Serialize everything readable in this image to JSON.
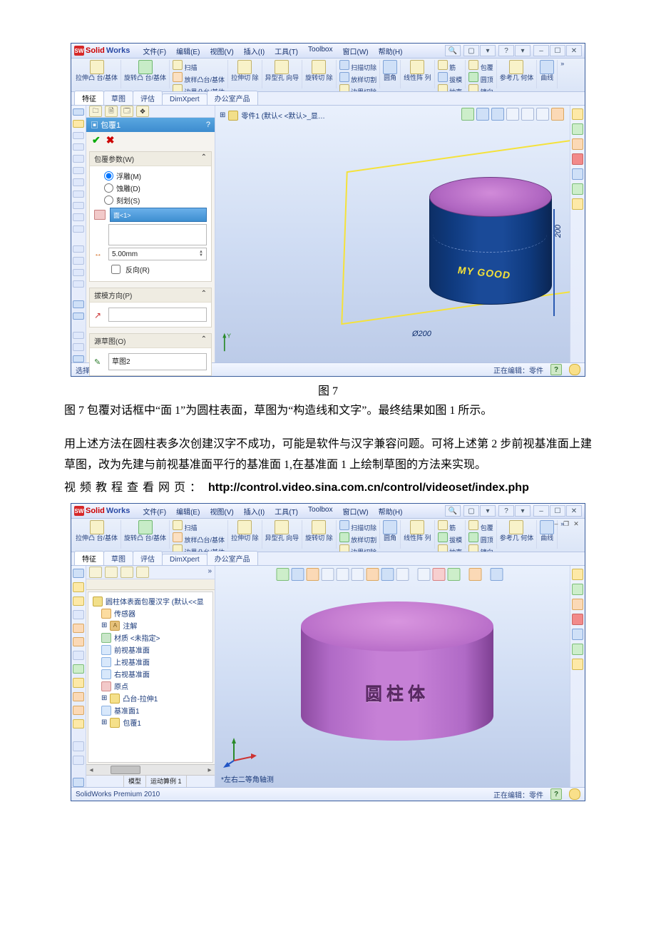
{
  "doc": {
    "fig7_caption": "图 7",
    "para1": "图 7 包覆对话框中“面 1”为圆柱表面，草图为“构造线和文字”。最终结果如图 1 所示。",
    "para2": "用上述方法在圆柱表多次创建汉字不成功，可能是软件与汉字兼容问题。可将上述第 2 步前视基准面上建草图，改为先建与前视基准面平行的基准面 1,在基准面 1 上绘制草图的方法来实现。",
    "para3_prefix": "视频教程查看网页：",
    "para3_url": "http://control.video.sina.com.cn/control/videoset/index.php"
  },
  "sw": {
    "brand_solid": "Solid",
    "brand_works": "Works",
    "logo_glyph": "SW",
    "menus": [
      "文件(F)",
      "编辑(E)",
      "视图(V)",
      "插入(I)",
      "工具(T)",
      "Toolbox",
      "窗口(W)",
      "帮助(H)"
    ],
    "winbtns": [
      "–",
      "☐",
      "✕"
    ],
    "help_glyph": "?",
    "search_glyph": "🔍",
    "doc_glyph": "▢",
    "ribbon": {
      "extrude": "拉伸凸\n台/基体",
      "revolve": "旋转凸\n台/基体",
      "sweep": "扫描",
      "loft": "放样凸台/基体",
      "boundary": "边界凸台/基体",
      "cut_extrude": "拉伸切\n除",
      "hole": "异型孔\n向导",
      "cut_revolve": "旋转切\n除",
      "cut_sweep": "扫描切除",
      "cut_loft": "放样切割",
      "cut_boundary": "边界切除",
      "fillet": "圆角",
      "pattern": "线性阵\n列",
      "rib": "筋",
      "draft": "拔模",
      "shell": "抽壳",
      "wrap": "包覆",
      "dome": "圆顶",
      "mirror": "镜向",
      "refgeom": "参考几\n何体",
      "curves": "曲线",
      "more": "»"
    },
    "tabs": [
      "特征",
      "草图",
      "评估",
      "DimXpert",
      "办公室产品"
    ]
  },
  "pm": {
    "title": "包覆1",
    "title_icon": "?",
    "ok": "✔",
    "cancel": "✖",
    "sec_params": "包覆参数(W)",
    "collapse": "⌃",
    "radio_emboss": "浮雕(M)",
    "radio_deboss": "蚀雕(D)",
    "radio_scribe": "刻划(S)",
    "face_sel": "面<1>",
    "thickness": "5.00mm",
    "reverse": "反向(R)",
    "sec_dir": "拔模方向(P)",
    "sec_src": "源草图(O)",
    "src_value": "草图2"
  },
  "vp1": {
    "tree_root": "零件1  (默认< <默认>_显…",
    "text_on_cyl": "MY GOOD",
    "dim_d": "Ø200",
    "dim_h": "200",
    "triad_y": "Y"
  },
  "status1": {
    "left": "选择要解除包覆于草图基准面的面。",
    "editing": "正在编辑：零件",
    "q": "?"
  },
  "tree2": {
    "root": "圆柱体表面包覆汉字  (默认<<显",
    "sensors": "传感器",
    "annotations": "注解",
    "material": "材质 <未指定>",
    "front": "前视基准面",
    "top": "上视基准面",
    "right": "右视基准面",
    "origin": "原点",
    "extrude": "凸台-拉伸1",
    "plane1": "基准面1",
    "wrap1": "包覆1",
    "tab_model": "模型",
    "tab_motion": "运动算例 1"
  },
  "vp2": {
    "cyl_text": "圆柱体",
    "view_label": "*左右二等角轴测"
  },
  "status2": {
    "left": "SolidWorks Premium 2010",
    "editing": "正在编辑：零件"
  }
}
